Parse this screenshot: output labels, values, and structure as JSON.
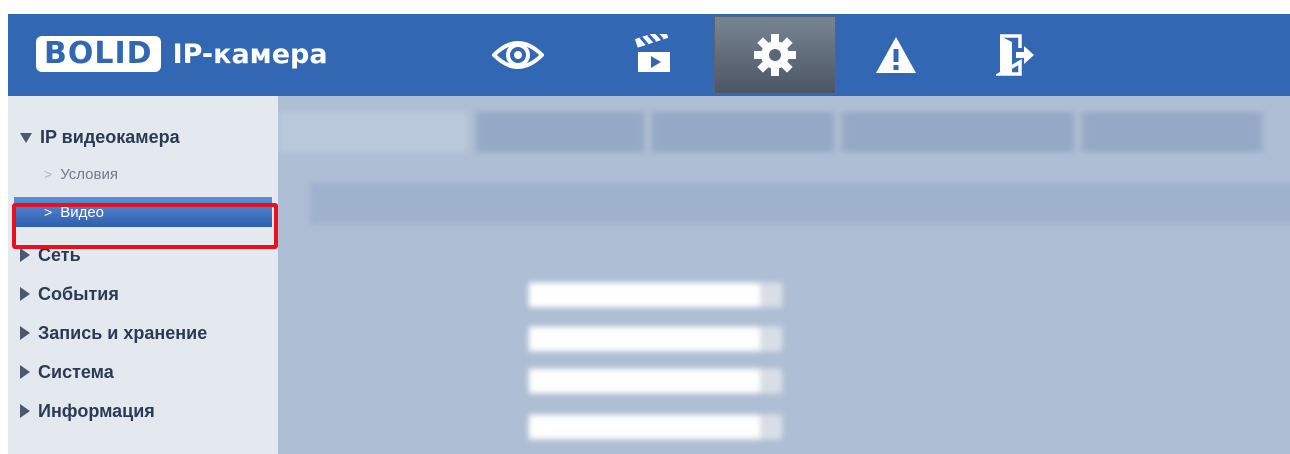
{
  "header": {
    "logo_text": "BOLID",
    "app_title": "IP-камера",
    "nav": [
      {
        "name": "live-view",
        "icon": "eye-icon"
      },
      {
        "name": "playback",
        "icon": "clapperboard-icon"
      },
      {
        "name": "settings",
        "icon": "gear-icon",
        "active": true
      },
      {
        "name": "alarms",
        "icon": "warning-icon"
      },
      {
        "name": "logout",
        "icon": "logout-icon"
      }
    ]
  },
  "sidebar": {
    "sections": [
      {
        "label": "IP видеокамера",
        "expanded": true
      },
      {
        "label": "Сеть",
        "expanded": false
      },
      {
        "label": "События",
        "expanded": false
      },
      {
        "label": "Запись и хранение",
        "expanded": false
      },
      {
        "label": "Система",
        "expanded": false
      },
      {
        "label": "Информация",
        "expanded": false
      }
    ],
    "subitems": [
      {
        "label": "Условия",
        "selected": false
      },
      {
        "label": "Видео",
        "selected": true
      }
    ]
  },
  "colors": {
    "header_bg": "#3167b3",
    "highlight_border": "#e8101c",
    "selected_item": "#2d5fae"
  }
}
